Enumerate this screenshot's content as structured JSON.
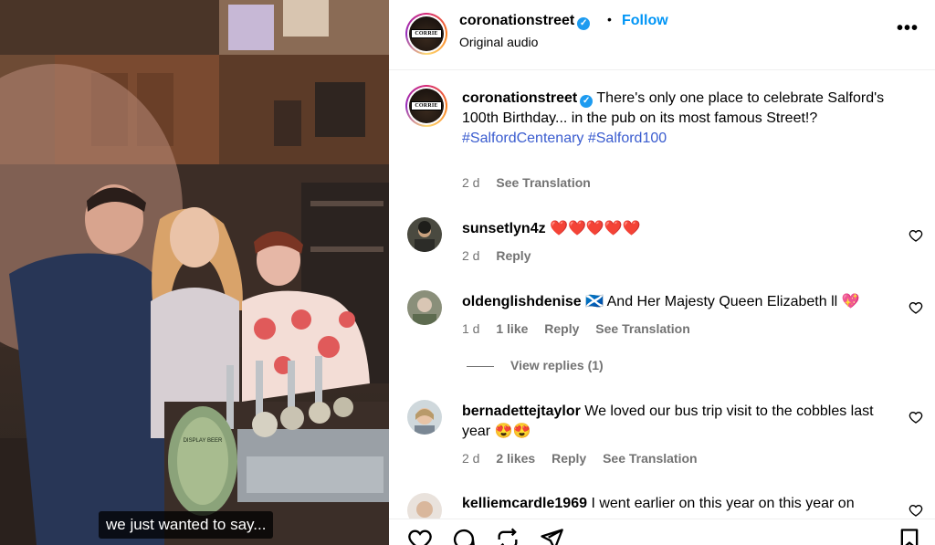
{
  "video": {
    "subtitle": "we just wanted to say...",
    "sign_text": "DISPLAY BEER"
  },
  "header": {
    "username": "coronationstreet",
    "follow_label": "Follow",
    "audio_label": "Original audio",
    "more_label": "•••",
    "logo_text": "CORRIE"
  },
  "caption": {
    "username": "coronationstreet",
    "body": "There's only one place to celebrate Salford's 100th Birthday... in the pub on its most famous Street!?",
    "hashtags": "#SalfordCentenary #Salford100",
    "time": "2 d",
    "translation_label": "See Translation"
  },
  "comments": [
    {
      "username": "sunsetlyn4z",
      "text": "❤️❤️❤️❤️❤️",
      "time": "2 d",
      "likes": "",
      "reply_label": "Reply",
      "translation_label": ""
    },
    {
      "username": "oldenglishdenise",
      "text": "🏴󠁧󠁢󠁳󠁣󠁴󠁿 And Her Majesty Queen Elizabeth ll 💖",
      "time": "1 d",
      "likes": "1 like",
      "reply_label": "Reply",
      "translation_label": "See Translation"
    },
    {
      "username": "bernadettejtaylor",
      "text": "We loved our bus trip visit to the cobbles last year 😍😍",
      "time": "2 d",
      "likes": "2 likes",
      "reply_label": "Reply",
      "translation_label": "See Translation"
    },
    {
      "username": "kelliemcardle1969",
      "text": "I went earlier on this year on this year on",
      "time": "",
      "likes": "",
      "reply_label": "",
      "translation_label": ""
    }
  ],
  "view_replies_label": "View replies (1)",
  "colors": {
    "link": "#0095f6",
    "muted": "#737373",
    "hashtag": "#3a5ccf",
    "verified": "#1d9bf0"
  }
}
